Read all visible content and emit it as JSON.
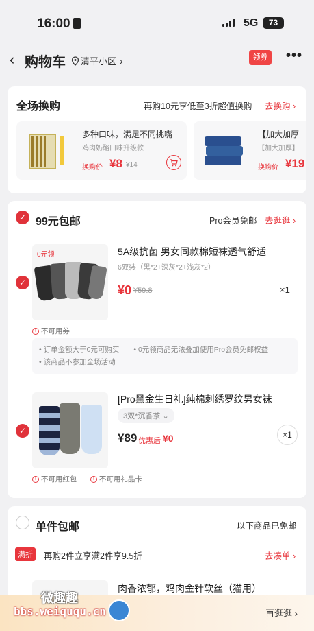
{
  "status_bar": {
    "time": "16:00",
    "network": "5G",
    "battery": "73"
  },
  "nav": {
    "back_icon": "‹",
    "title": "购物车",
    "location": "清平小区",
    "coupon_label": "领券",
    "more_icon": "•••"
  },
  "swap_section": {
    "title": "全场换购",
    "promo": "再购10元享低至3折超值换购",
    "link": "去换购",
    "items": [
      {
        "title": "多种口味，满足不同挑嘴",
        "subtitle": "鸡肉奶酪口味升级款",
        "price_label": "换购价",
        "price": "¥8",
        "orig_price": "¥14"
      },
      {
        "title": "【加大加厚",
        "subtitle": "【加大加厚】",
        "price_label": "换购价",
        "price": "¥19"
      }
    ]
  },
  "free_ship_group": {
    "title": "99元包邮",
    "pro_label": "Pro会员免邮",
    "link": "去逛逛",
    "items": [
      {
        "tag": "0元领",
        "name": "5A级抗菌 男女同款棉短袜透气舒适",
        "spec": "6双装（黑*2+深灰*2+浅灰*2）",
        "price": "¥0",
        "orig_price": "¥59.8",
        "qty": "×1",
        "warning": "不可用券"
      },
      {
        "name": "[Pro黑金生日礼]纯棉刺绣罗纹男女袜",
        "spec": "3双*沉香茶",
        "price": "¥89",
        "after_label": "优惠后",
        "after_price": "¥0",
        "qty": "×1",
        "warnings": [
          "不可用红包",
          "不可用礼品卡"
        ]
      }
    ],
    "notes": [
      "订单金额大于0元可购买",
      "0元领商品无法叠加使用Pro会员免邮权益",
      "该商品不参加全场活动"
    ]
  },
  "single_group": {
    "title": "单件包邮",
    "right": "以下商品已免邮",
    "promo_tag": "满折",
    "promo": "再购2件立享满2件享9.5折",
    "link": "去凑单",
    "product_title": "肉香浓郁，鸡肉金针软丝（猫用）"
  },
  "bottom_bar": {
    "watermark_top": "微趣趣",
    "watermark_url": "bbs.weiququ.cn",
    "right_link": "再逛逛"
  },
  "colors": {
    "accent": "#e8363d",
    "background": "#f1f1f3"
  }
}
